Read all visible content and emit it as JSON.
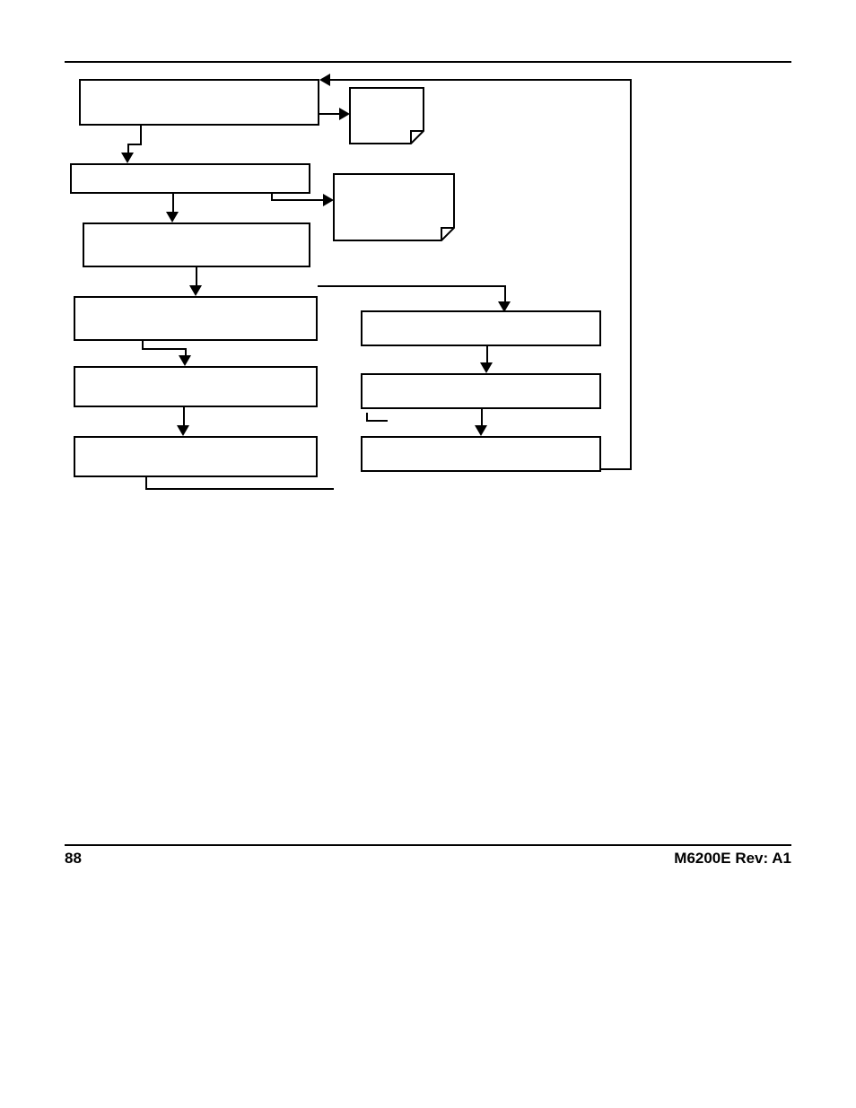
{
  "footer": {
    "page_number": "88",
    "revision": "M6200E Rev: A1"
  }
}
